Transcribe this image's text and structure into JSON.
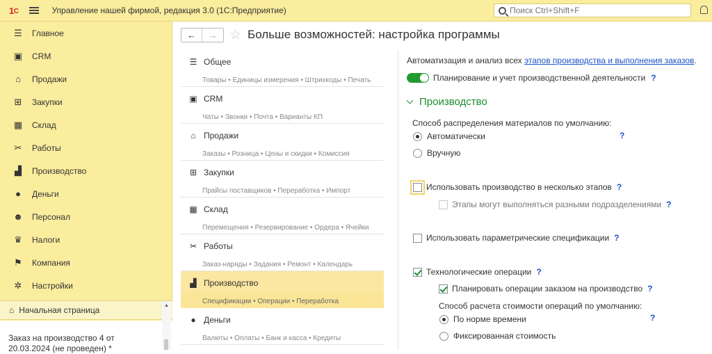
{
  "topbar": {
    "logo": "1С",
    "title": "Управление нашей фирмой, редакция 3.0  (1С:Предприятие)",
    "search_placeholder": "Поиск Ctrl+Shift+F"
  },
  "sidebar": {
    "items": [
      {
        "label": "Главное",
        "icon": "menu-lines-icon"
      },
      {
        "label": "CRM",
        "icon": "contact-card-icon"
      },
      {
        "label": "Продажи",
        "icon": "shop-icon"
      },
      {
        "label": "Закупки",
        "icon": "cart-icon"
      },
      {
        "label": "Склад",
        "icon": "warehouse-icon"
      },
      {
        "label": "Работы",
        "icon": "tools-icon"
      },
      {
        "label": "Производство",
        "icon": "factory-icon"
      },
      {
        "label": "Деньги",
        "icon": "ruble-icon"
      },
      {
        "label": "Персонал",
        "icon": "people-icon"
      },
      {
        "label": "Налоги",
        "icon": "emblem-icon"
      },
      {
        "label": "Компания",
        "icon": "flag-icon"
      },
      {
        "label": "Настройки",
        "icon": "gear-icon"
      }
    ],
    "home_label": "Начальная страница",
    "open_windows": [
      "Заказ на производство 4 от 20.03.2024 (не проведен) *"
    ]
  },
  "header": {
    "title": "Больше возможностей: настройка программы"
  },
  "sections": [
    {
      "label": "Общее",
      "sub": "Товары • Единицы измерения • Штрихкоды • Печать",
      "icon": "menu-lines-icon",
      "active": false
    },
    {
      "label": "CRM",
      "sub": "Чаты • Звонки • Почта • Варианты КП",
      "icon": "contact-card-icon",
      "active": false
    },
    {
      "label": "Продажи",
      "sub": "Заказы • Розница • Цены и скидки • Комиссия",
      "icon": "shop-icon",
      "active": false
    },
    {
      "label": "Закупки",
      "sub": "Прайсы поставщиков • Переработка • Импорт",
      "icon": "cart-icon",
      "active": false
    },
    {
      "label": "Склад",
      "sub": "Перемещения • Резервирование • Ордера • Ячейки",
      "icon": "warehouse-icon",
      "active": false
    },
    {
      "label": "Работы",
      "sub": "Заказ-наряды • Задания • Ремонт • Календарь",
      "icon": "tools-icon",
      "active": false
    },
    {
      "label": "Производство",
      "sub": "Спецификации • Операции • Переработка",
      "icon": "factory-icon",
      "active": true
    },
    {
      "label": "Деньги",
      "sub": "Валюты • Оплаты • Банк и касса • Кредиты",
      "icon": "ruble-icon",
      "active": false
    }
  ],
  "settings": {
    "intro_text": "Автоматизация и анализ всех ",
    "intro_link": "этапов производства и выполнения заказов",
    "intro_end": ".",
    "toggle_label": "Планирование и учет производственной деятельности",
    "toggle_on": true,
    "group_title": "Производство",
    "distribution_label": "Способ распределения материалов по умолчанию:",
    "radio_auto": "Автоматически",
    "radio_manual": "Вручную",
    "cb_multistage": "Использовать производство в несколько этапов",
    "cb_stages_departments": "Этапы могут выполняться разными подразделениями",
    "cb_parametric": "Использовать параметрические спецификации",
    "cb_operations": "Технологические операции",
    "cb_plan_operations": "Планировать операции заказом на производство",
    "cost_method_label": "Способ расчета стоимости операций по умолчанию:",
    "radio_norm_time": "По норме времени",
    "radio_fixed": "Фиксированная стоимость",
    "help": "?"
  },
  "colors": {
    "sidebar_bg": "#fbed9e",
    "accent_green": "#1d8d2e",
    "link_blue": "#1b52c7",
    "active_section": "#fbe7a1"
  }
}
